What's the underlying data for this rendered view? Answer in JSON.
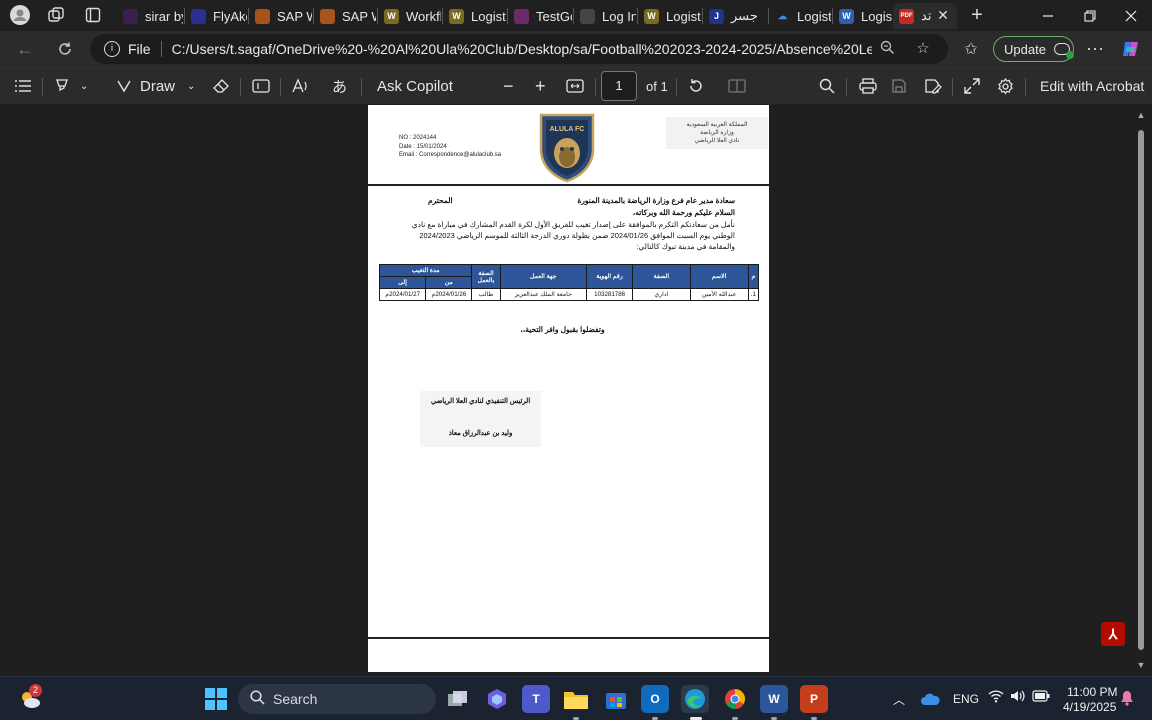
{
  "browser": {
    "tabs": [
      {
        "label": "sirar by",
        "color": "#3a1f4f"
      },
      {
        "label": "FlyAke",
        "color": "#2b2f8f"
      },
      {
        "label": "SAP W",
        "color": "#a7541b"
      },
      {
        "label": "SAP W",
        "color": "#a7541b"
      },
      {
        "label": "Workfl",
        "color": "#7a6a1f"
      },
      {
        "label": "Logisti",
        "color": "#7a6a1f"
      },
      {
        "label": "TestGo",
        "color": "#6b2b6b"
      },
      {
        "label": "Log In",
        "color": "#444444"
      },
      {
        "label": "Logisti",
        "color": "#7a6a1f"
      },
      {
        "label": "جسر",
        "color": "#22338f"
      },
      {
        "label": "Logisti",
        "color": "#1f5fb0"
      },
      {
        "label": "Logisti",
        "color": "#2b5fb0"
      },
      {
        "label": "تد",
        "color": "#c62828"
      }
    ],
    "new_tab_symbol": "+",
    "address": {
      "scheme_label": "File",
      "url": "C:/Users/t.sagaf/OneDrive%20-%20Al%20Ula%20Club/Desktop/sa/Football%202023-2024-2025/Absence%20Letters/%E2%..."
    },
    "update_label": "Update"
  },
  "pdf_toolbar": {
    "draw_label": "Draw",
    "copilot_label": "Ask Copilot",
    "page_current": "1",
    "page_total": "of 1",
    "edit_label": "Edit with Acrobat"
  },
  "letter": {
    "ref_no": "NO    : 2024144",
    "date": "Date  : 15/01/2024",
    "email": "Email : Correspondence@alulaclub.sa",
    "gov_lines": [
      "المملكة العربية السعودية",
      "وزارة الرياضة",
      "نادي العلا الرياضي"
    ],
    "logo_text": "ALULA FC",
    "recipient": "سعادة مدير عام فرع وزارة الرياضة بالمدينة المنورة",
    "honorific": "المحترم",
    "greeting": "السلام عليكم ورحمة الله وبركاته،",
    "paragraph": "نأمل من سعادتكم التكرم بالموافقة على إصدار تغيب للفريق الأول لكرة القدم المشارك في مباراة مع نادي الوطني يوم السبت الموافق 2024/01/26 ضمن بطولة دوري الدرجة الثالثة للموسم الرياضي 2024/2023 والمقامة في مدينة تبوك كالتالي:",
    "table": {
      "headers": {
        "num": "م",
        "name": "الاسم",
        "title": "الصفة",
        "id": "رقم الهوية",
        "employer": "جهة العمل",
        "work_title": "الصفة بالعمل",
        "period": "مدة التغيب",
        "from": "من",
        "to": "إلى"
      },
      "rows": [
        {
          "num": "1.",
          "name": "عبدالله الأمين",
          "title": "اداري",
          "id": "103281786",
          "employer": "جامعة الملك عبدالعزيز",
          "work_title": "طالب",
          "from": "2024/01/26م",
          "to": "2024/01/27م"
        }
      ]
    },
    "closing": "وتفضلوا بقبول وافر التحية،،",
    "signer_title": "الرئيس التنفيذي لنادي العلا الرياضي",
    "signer_name": "وليد بن عبدالرزاق معاذ"
  },
  "taskbar": {
    "search_label": "Search",
    "widgets_badge": "2",
    "language": "ENG",
    "time": "11:00 PM",
    "date": "4/19/2025"
  }
}
